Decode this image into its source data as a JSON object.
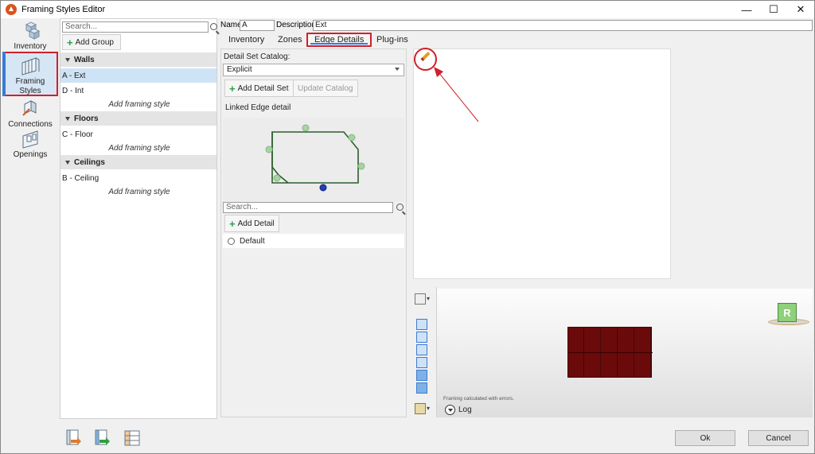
{
  "window": {
    "title": "Framing Styles Editor"
  },
  "window_controls": {
    "minimize": "—",
    "maximize": "☐",
    "close": "✕"
  },
  "nav": {
    "items": [
      {
        "label": "Inventory"
      },
      {
        "label": "Framing Styles"
      },
      {
        "label": "Connections"
      },
      {
        "label": "Openings"
      }
    ]
  },
  "groups": {
    "search_placeholder": "Search...",
    "add_group_label": "Add Group",
    "sections": [
      {
        "title": "Walls",
        "items": [
          "A - Ext",
          "D - Int"
        ],
        "add_label": "Add framing style"
      },
      {
        "title": "Floors",
        "items": [
          "C - Floor"
        ],
        "add_label": "Add framing style"
      },
      {
        "title": "Ceilings",
        "items": [
          "B - Ceiling"
        ],
        "add_label": "Add framing style"
      }
    ]
  },
  "style_header": {
    "name_label": "Name",
    "name_value": "A",
    "description_label": "Description",
    "description_value": "Ext"
  },
  "tabs": [
    {
      "label": "Inventory"
    },
    {
      "label": "Zones"
    },
    {
      "label": "Edge Details",
      "active": true
    },
    {
      "label": "Plug-ins"
    }
  ],
  "edge_details": {
    "catalog_label": "Detail Set Catalog:",
    "catalog_value": "Explicit",
    "add_detail_set_label": "Add Detail Set",
    "update_catalog_label": "Update Catalog",
    "linked_label": "Linked Edge detail",
    "search_placeholder": "Search...",
    "add_detail_label": "Add Detail",
    "details": [
      {
        "label": "Default"
      }
    ]
  },
  "viewer": {
    "status_message": "Framing calculated with errors.",
    "log_label": "Log",
    "view_cube_label": "R"
  },
  "dialog": {
    "ok_label": "Ok",
    "cancel_label": "Cancel"
  },
  "colors": {
    "highlight_red": "#d0202a",
    "selection_blue": "#cfe3f6",
    "accent_blue": "#3a7bd5",
    "add_green": "#2f9e44",
    "model_red": "#6b0a0a"
  }
}
